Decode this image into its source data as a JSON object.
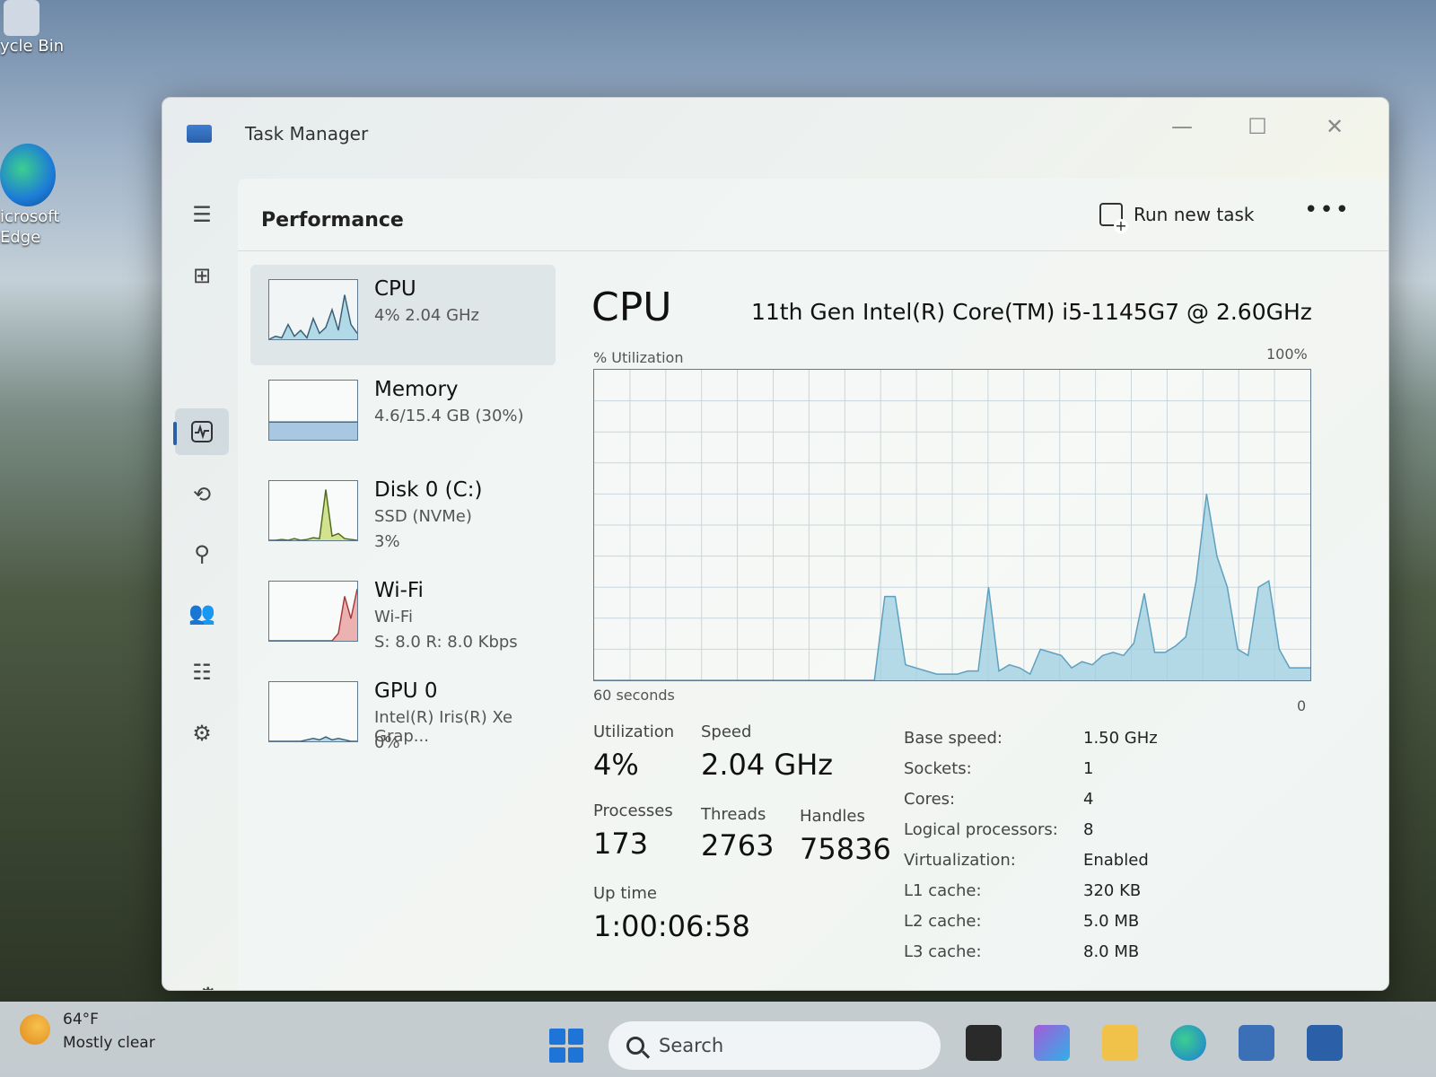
{
  "desktop": {
    "recycle_bin": "ycle Bin",
    "edge_line1": "icrosoft",
    "edge_line2": "Edge"
  },
  "window": {
    "title": "Task Manager",
    "minimize_glyph": "—",
    "maximize_glyph": "☐",
    "close_glyph": "✕"
  },
  "header": {
    "page_title": "Performance",
    "run_new_task": "Run new task",
    "more_glyph": "•••"
  },
  "resources": [
    {
      "name": "CPU",
      "sub": "4%  2.04 GHz",
      "sub2": ""
    },
    {
      "name": "Memory",
      "sub": "4.6/15.4 GB (30%)",
      "sub2": ""
    },
    {
      "name": "Disk 0 (C:)",
      "sub": "SSD (NVMe)",
      "sub2": "3%"
    },
    {
      "name": "Wi-Fi",
      "sub": "Wi-Fi",
      "sub2": "S: 8.0  R: 8.0 Kbps"
    },
    {
      "name": "GPU 0",
      "sub": "Intel(R) Iris(R) Xe Grap...",
      "sub2": "0%"
    }
  ],
  "detail": {
    "heading": "CPU",
    "model": "11th Gen Intel(R) Core(TM) i5-1145G7 @ 2.60GHz",
    "util_label": "% Utilization",
    "util_max": "100%",
    "axis_left": "60 seconds",
    "axis_right": "0"
  },
  "stats": {
    "utilization_label": "Utilization",
    "utilization": "4%",
    "speed_label": "Speed",
    "speed": "2.04 GHz",
    "processes_label": "Processes",
    "processes": "173",
    "threads_label": "Threads",
    "threads": "2763",
    "handles_label": "Handles",
    "handles": "75836",
    "uptime_label": "Up time",
    "uptime": "1:00:06:58"
  },
  "specs": [
    {
      "k": "Base speed:",
      "v": "1.50 GHz"
    },
    {
      "k": "Sockets:",
      "v": "1"
    },
    {
      "k": "Cores:",
      "v": "4"
    },
    {
      "k": "Logical processors:",
      "v": "8"
    },
    {
      "k": "Virtualization:",
      "v": "Enabled"
    },
    {
      "k": "L1 cache:",
      "v": "320 KB"
    },
    {
      "k": "L2 cache:",
      "v": "5.0 MB"
    },
    {
      "k": "L3 cache:",
      "v": "8.0 MB"
    }
  ],
  "chart_data": {
    "type": "area",
    "ylim": [
      0,
      100
    ],
    "values": [
      0,
      0,
      0,
      0,
      0,
      0,
      0,
      0,
      0,
      0,
      0,
      0,
      0,
      0,
      0,
      0,
      0,
      0,
      0,
      0,
      0,
      0,
      0,
      0,
      0,
      0,
      0,
      0,
      27,
      27,
      5,
      4,
      3,
      2,
      2,
      2,
      3,
      3,
      30,
      3,
      5,
      4,
      2,
      10,
      9,
      8,
      4,
      6,
      5,
      8,
      9,
      8,
      12,
      28,
      9,
      9,
      11,
      14,
      32,
      60,
      40,
      30,
      10,
      8,
      30,
      32,
      10,
      4,
      4,
      4
    ],
    "color": "#9ccfe0"
  },
  "thumbs": {
    "cpu": [
      0,
      2,
      1,
      10,
      2,
      6,
      1,
      14,
      4,
      8,
      20,
      6,
      30,
      10,
      4
    ],
    "memory": [
      30,
      30,
      30,
      30,
      30,
      30,
      30,
      30,
      30,
      30,
      30,
      30,
      30,
      30,
      30
    ],
    "disk": [
      0,
      0,
      1,
      0,
      2,
      0,
      1,
      3,
      2,
      60,
      5,
      8,
      2,
      1,
      0
    ],
    "wifi": [
      0,
      0,
      0,
      0,
      0,
      0,
      0,
      0,
      0,
      0,
      0,
      10,
      60,
      30,
      70
    ],
    "gpu": [
      0,
      0,
      0,
      0,
      0,
      0,
      1,
      2,
      1,
      3,
      1,
      2,
      1,
      0,
      0
    ]
  },
  "taskbar": {
    "temp": "64°F",
    "condition": "Mostly clear",
    "search_label": "Search"
  },
  "colors": {
    "accent": "#2b5fa8",
    "graph_fill": "#9ccfe0",
    "graph_line": "#5f9fbf"
  }
}
